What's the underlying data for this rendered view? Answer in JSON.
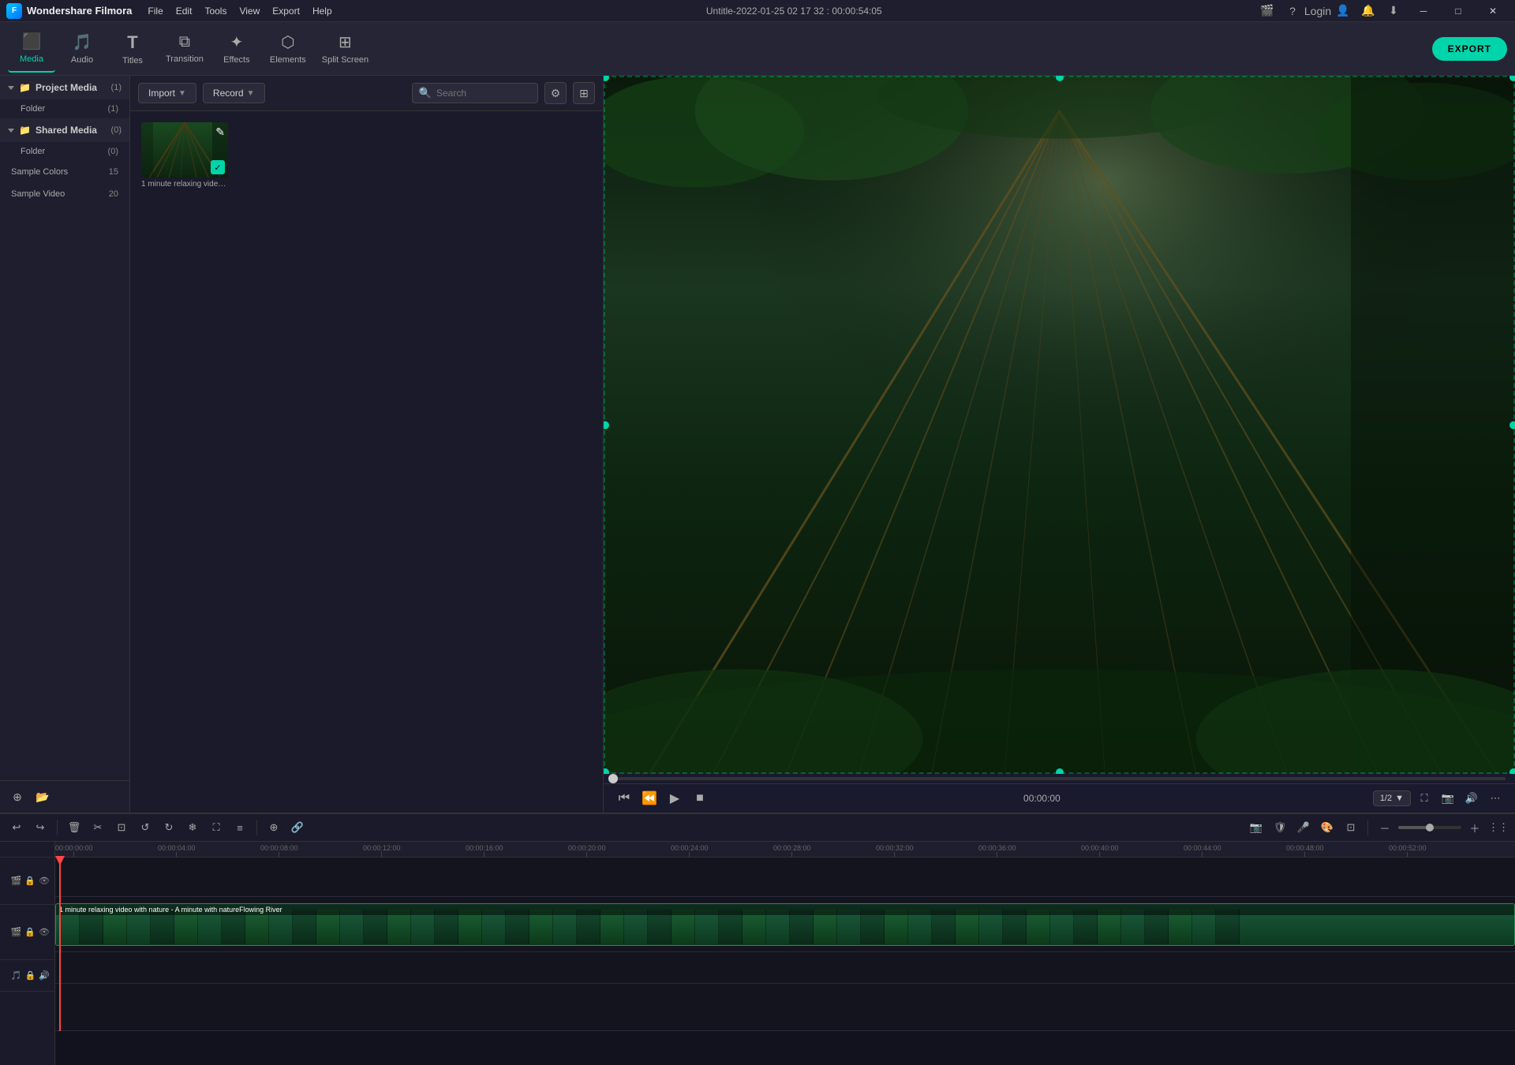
{
  "app": {
    "name": "Wondershare Filmora",
    "title": "Untitle-2022-01-25 02 17 32 : 00:00:54:05"
  },
  "menu": {
    "items": [
      "File",
      "Edit",
      "Tools",
      "View",
      "Export",
      "Help"
    ]
  },
  "toolbar": {
    "items": [
      {
        "id": "media",
        "label": "Media",
        "icon": "⬛",
        "active": true
      },
      {
        "id": "audio",
        "label": "Audio",
        "icon": "🎵",
        "active": false
      },
      {
        "id": "titles",
        "label": "Titles",
        "icon": "T",
        "active": false
      },
      {
        "id": "transition",
        "label": "Transition",
        "icon": "⧉",
        "active": false
      },
      {
        "id": "effects",
        "label": "Effects",
        "icon": "✦",
        "active": false
      },
      {
        "id": "elements",
        "label": "Elements",
        "icon": "⬡",
        "active": false
      },
      {
        "id": "split-screen",
        "label": "Split Screen",
        "icon": "⊞",
        "active": false
      }
    ],
    "export_label": "EXPORT"
  },
  "left_panel": {
    "project_media": {
      "label": "Project Media",
      "count": "(1)",
      "children": [
        {
          "label": "Folder",
          "count": "(1)"
        }
      ]
    },
    "shared_media": {
      "label": "Shared Media",
      "count": "(0)",
      "children": [
        {
          "label": "Folder",
          "count": "(0)"
        }
      ]
    },
    "sample_colors": {
      "label": "Sample Colors",
      "count": "15"
    },
    "sample_video": {
      "label": "Sample Video",
      "count": "20"
    }
  },
  "media_panel": {
    "import_label": "Import",
    "record_label": "Record",
    "search_placeholder": "Search",
    "items": [
      {
        "label": "1 minute relaxing video ...",
        "type": "video",
        "checked": true
      }
    ]
  },
  "preview": {
    "time": "00:00:00",
    "quality": "1/2"
  },
  "timeline": {
    "timecodes": [
      "00:00:00:00",
      "00:00:04:00",
      "00:00:08:00",
      "00:00:12:00",
      "00:00:16:00",
      "00:00:20:00",
      "00:00:24:00",
      "00:00:28:00",
      "00:00:32:00",
      "00:00:36:00",
      "00:00:40:00",
      "00:00:44:00",
      "00:00:48:00",
      "00:00:52:00"
    ],
    "video_clip": {
      "label": "1 minute relaxing video with nature - A minute with natureFlowing River"
    }
  },
  "window_controls": {
    "minimize": "─",
    "maximize": "□",
    "close": "✕"
  }
}
